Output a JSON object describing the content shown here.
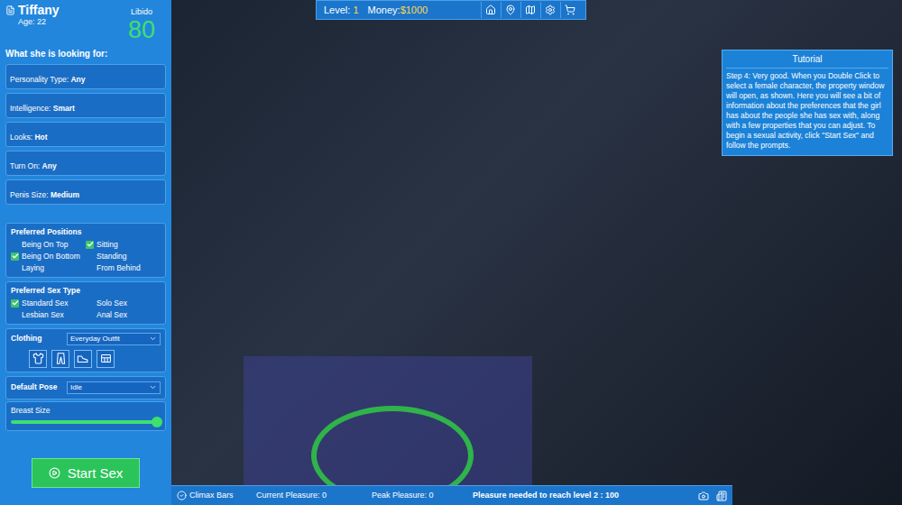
{
  "character": {
    "name": "Tiffany",
    "age": "Age: 22",
    "libido_label": "Libido",
    "libido": "80"
  },
  "preferences_title": "What she is looking for:",
  "preferences": [
    {
      "label": "Personality Type:",
      "value": "Any"
    },
    {
      "label": "Intelligence:",
      "value": "Smart"
    },
    {
      "label": "Looks:",
      "value": "Hot"
    },
    {
      "label": "Turn On:",
      "value": "Any"
    },
    {
      "label": "Penis Size:",
      "value": "Medium"
    }
  ],
  "positions": {
    "title": "Preferred Positions",
    "items": [
      {
        "label": "Being On Top",
        "checked": false
      },
      {
        "label": "Being On Bottom",
        "checked": true
      },
      {
        "label": "Laying",
        "checked": false
      },
      {
        "label": "Sitting",
        "checked": true
      },
      {
        "label": "Standing",
        "checked": false
      },
      {
        "label": "From Behind",
        "checked": false
      }
    ]
  },
  "sex_types": {
    "title": "Preferred Sex Type",
    "items": [
      {
        "label": "Standard Sex",
        "checked": true
      },
      {
        "label": "Lesbian Sex",
        "checked": false
      },
      {
        "label": "Solo Sex",
        "checked": false
      },
      {
        "label": "Anal Sex",
        "checked": false
      }
    ]
  },
  "clothing": {
    "label": "Clothing",
    "value": "Everyday Outfit"
  },
  "default_pose": {
    "label": "Default Pose",
    "value": "Idle"
  },
  "breast_size": {
    "label": "Breast Size",
    "level": 1.0
  },
  "start_button": "Start Sex",
  "top_bar": {
    "level_label": "Level:",
    "level": "1",
    "money_label": "Money:",
    "money": "$1000"
  },
  "tutorial": {
    "title": "Tutorial",
    "text": "Step 4: Very good. When you Double Click to select a female character, the property window will open, as shown. Here you will see a bit of information about the preferences that the girl has about the people she has sex with, along with a few properties that you can adjust. To begin a sexual activity, click \"Start Sex\" and follow the prompts."
  },
  "status_bar": {
    "climax_bars": "Climax Bars",
    "current_pleasure": "Current Pleasure: 0",
    "peak_pleasure": "Peak Pleasure: 0",
    "level_goal": "Pleasure needed to reach level 2 : 100"
  }
}
